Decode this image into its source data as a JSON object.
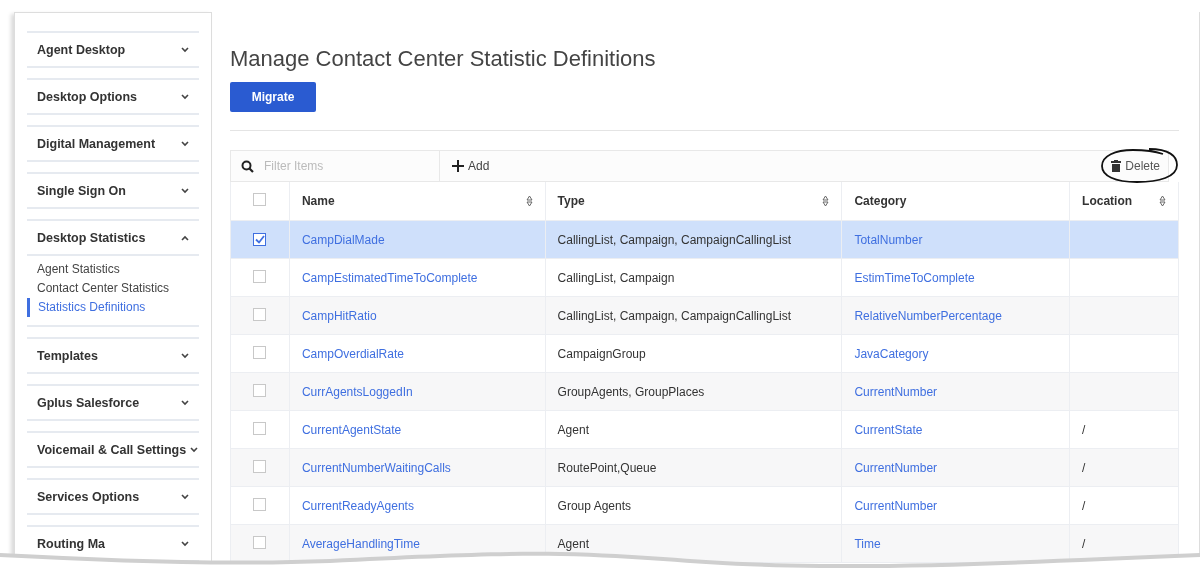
{
  "sidebar": {
    "sections": [
      {
        "label": "Agent Desktop",
        "expanded": false
      },
      {
        "label": "Desktop Options",
        "expanded": false
      },
      {
        "label": "Digital Management",
        "expanded": false
      },
      {
        "label": "Single Sign On",
        "expanded": false
      },
      {
        "label": "Desktop Statistics",
        "expanded": true,
        "children": [
          {
            "label": "Agent Statistics",
            "selected": false
          },
          {
            "label": "Contact Center Statistics",
            "selected": false
          },
          {
            "label": "Statistics Definitions",
            "selected": true
          }
        ]
      },
      {
        "label": "Templates",
        "expanded": false
      },
      {
        "label": "Gplus Salesforce",
        "expanded": false
      },
      {
        "label": "Voicemail & Call Settings",
        "expanded": false
      },
      {
        "label": "Services Options",
        "expanded": false
      },
      {
        "label": "Routing Ma",
        "expanded": false
      }
    ]
  },
  "page": {
    "title": "Manage Contact Center Statistic Definitions",
    "migrate_button": "Migrate"
  },
  "toolbar": {
    "filter_placeholder": "Filter Items",
    "add_button": "Add",
    "delete_button": "Delete"
  },
  "table": {
    "select_all": {
      "checked": false
    },
    "columns": [
      {
        "label": "Name",
        "sortable": true
      },
      {
        "label": "Type",
        "sortable": true
      },
      {
        "label": "Category",
        "sortable": false
      },
      {
        "label": "Location",
        "sortable": true
      }
    ],
    "rows": [
      {
        "selected": true,
        "name": "CampDialMade",
        "type": "CallingList, Campaign, CampaignCallingList",
        "category": "TotalNumber",
        "location": ""
      },
      {
        "selected": false,
        "name": "CampEstimatedTimeToComplete",
        "type": "CallingList, Campaign",
        "category": "EstimTimeToComplete",
        "location": ""
      },
      {
        "selected": false,
        "name": "CampHitRatio",
        "type": "CallingList, Campaign, CampaignCallingList",
        "category": "RelativeNumberPercentage",
        "location": ""
      },
      {
        "selected": false,
        "name": "CampOverdialRate",
        "type": "CampaignGroup",
        "category": "JavaCategory",
        "location": ""
      },
      {
        "selected": false,
        "name": "CurrAgentsLoggedIn",
        "type": "GroupAgents, GroupPlaces",
        "category": "CurrentNumber",
        "location": ""
      },
      {
        "selected": false,
        "name": "CurrentAgentState",
        "type": "Agent",
        "category": "CurrentState",
        "location": "/"
      },
      {
        "selected": false,
        "name": "CurrentNumberWaitingCalls",
        "type": "RoutePoint,Queue",
        "category": "CurrentNumber",
        "location": "/"
      },
      {
        "selected": false,
        "name": "CurrentReadyAgents",
        "type": "Group Agents",
        "category": "CurrentNumber",
        "location": "/"
      },
      {
        "selected": false,
        "name": "AverageHandlingTime",
        "type": "Agent",
        "category": "Time",
        "location": "/"
      }
    ]
  }
}
